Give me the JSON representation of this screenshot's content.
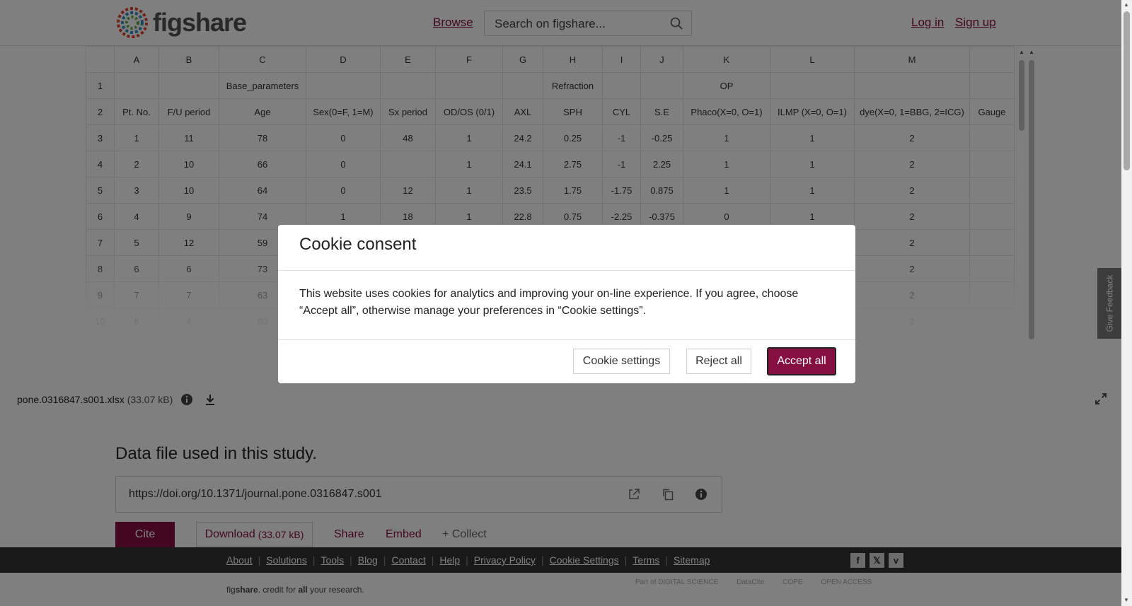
{
  "brand": {
    "logo_text": "figshare",
    "accent": "#860f42"
  },
  "header": {
    "browse": "Browse",
    "search_placeholder": "Search on figshare...",
    "login": "Log in",
    "signup": "Sign up"
  },
  "sheet": {
    "columns": [
      "",
      "A",
      "B",
      "C",
      "D",
      "E",
      "F",
      "G",
      "H",
      "I",
      "J",
      "K",
      "L",
      "M",
      ""
    ],
    "rows": [
      [
        "1",
        "",
        "",
        "Base_parameters",
        "",
        "",
        "",
        "",
        "Refraction",
        "",
        "",
        "OP",
        "",
        "",
        ""
      ],
      [
        "2",
        "Pt. No.",
        "F/U period",
        "Age",
        "Sex(0=F, 1=M)",
        "Sx period",
        "OD/OS (0/1)",
        "AXL",
        "SPH",
        "CYL",
        "S.E",
        "Phaco(X=0, O=1)",
        "ILMP (X=0, O=1)",
        "dye(X=0, 1=BBG, 2=ICG)",
        "Gauge"
      ],
      [
        "3",
        "1",
        "11",
        "78",
        "0",
        "48",
        "1",
        "24.2",
        "0.25",
        "-1",
        "-0.25",
        "1",
        "1",
        "2",
        ""
      ],
      [
        "4",
        "2",
        "10",
        "66",
        "0",
        "",
        "1",
        "24.1",
        "2.75",
        "-1",
        "2.25",
        "1",
        "1",
        "2",
        ""
      ],
      [
        "5",
        "3",
        "10",
        "64",
        "0",
        "12",
        "1",
        "23.5",
        "1.75",
        "-1.75",
        "0.875",
        "1",
        "1",
        "2",
        ""
      ],
      [
        "6",
        "4",
        "9",
        "74",
        "1",
        "18",
        "1",
        "22.8",
        "0.75",
        "-2.25",
        "-0.375",
        "0",
        "1",
        "2",
        ""
      ],
      [
        "7",
        "5",
        "12",
        "59",
        "",
        "",
        "",
        "",
        "",
        "",
        "",
        "",
        "",
        "2",
        ""
      ],
      [
        "8",
        "6",
        "6",
        "73",
        "",
        "",
        "",
        "",
        "",
        "",
        "",
        "",
        "",
        "2",
        ""
      ],
      [
        "9",
        "7",
        "7",
        "63",
        "",
        "",
        "",
        "",
        "",
        "",
        "",
        "",
        "",
        "2",
        ""
      ],
      [
        "10",
        "8",
        "4",
        "60",
        "",
        "",
        "",
        "",
        "",
        "",
        "",
        "",
        "",
        "2",
        ""
      ]
    ]
  },
  "file": {
    "name": "pone.0316847.s001.xlsx",
    "size": "(33.07 kB)"
  },
  "item": {
    "title": "Data file used in this study.",
    "doi": "https://doi.org/10.1371/journal.pone.0316847.s001",
    "cite": "Cite",
    "download": "Download",
    "download_size": "(33.07 kB)",
    "share": "Share",
    "embed": "Embed",
    "collect": "+ Collect"
  },
  "footer": {
    "links": [
      "About",
      "Solutions",
      "Tools",
      "Blog",
      "Contact",
      "Help",
      "Privacy Policy",
      "Cookie Settings",
      "Terms",
      "Sitemap"
    ],
    "tagline_pre": "fig",
    "tagline_bold": "share",
    "tagline_mid": ". credit for ",
    "tagline_bold2": "all",
    "tagline_post": " your research.",
    "partners": [
      "Part of DIGITAL SCIENCE",
      "DataCite",
      "COPE",
      "OPEN ACCESS"
    ]
  },
  "cookie": {
    "title": "Cookie consent",
    "body": "This website uses cookies for analytics and improving your on-line experience. If you agree, choose “Accept all”, otherwise manage your preferences in “Cookie settings”.",
    "settings": "Cookie settings",
    "reject": "Reject all",
    "accept": "Accept all"
  },
  "feedback": "Give Feedback"
}
